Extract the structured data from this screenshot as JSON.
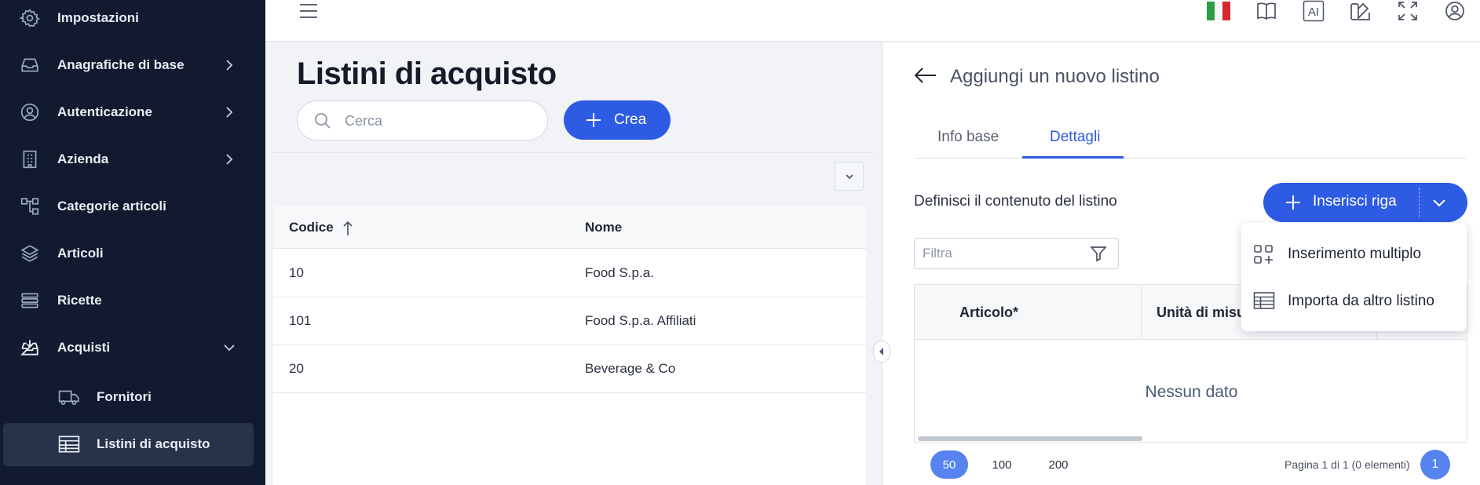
{
  "sidebar": {
    "items": [
      {
        "label": "Impostazioni",
        "icon": "gear-icon"
      },
      {
        "label": "Anagrafiche di base",
        "icon": "inbox-icon"
      },
      {
        "label": "Autenticazione",
        "icon": "user-circle-icon"
      },
      {
        "label": "Azienda",
        "icon": "building-icon"
      },
      {
        "label": "Categorie articoli",
        "icon": "hierarchy-icon"
      },
      {
        "label": "Articoli",
        "icon": "layers-icon"
      },
      {
        "label": "Ricette",
        "icon": "list-icon"
      },
      {
        "label": "Acquisti",
        "icon": "inbox-download-icon"
      }
    ],
    "sub_items": [
      {
        "label": "Fornitori",
        "icon": "truck-icon"
      },
      {
        "label": "Listini di acquisto",
        "icon": "table-icon"
      }
    ]
  },
  "topbar": {
    "icons": [
      "menu-icon",
      "italy-flag-icon",
      "book-icon",
      "ai-icon",
      "palette-icon",
      "fullscreen-icon",
      "user-account-icon"
    ],
    "ai_label": "AI"
  },
  "left": {
    "title": "Listini di acquisto",
    "search_placeholder": "Cerca",
    "create_label": "Crea",
    "columns": [
      "Codice",
      "Nome"
    ],
    "rows": [
      {
        "code": "10",
        "name": "Food S.p.a."
      },
      {
        "code": "101",
        "name": "Food S.p.a. Affiliati"
      },
      {
        "code": "20",
        "name": "Beverage & Co"
      }
    ]
  },
  "right": {
    "title": "Aggiungi un nuovo listino",
    "tabs": [
      "Info base",
      "Dettagli"
    ],
    "active_tab": "Dettagli",
    "section_label": "Definisci il contenuto del listino",
    "insert_label": "Inserisci riga",
    "filter_placeholder": "Filtra",
    "columns": [
      "Articolo*",
      "Unità di misura"
    ],
    "empty_text": "Nessun dato",
    "page_sizes": [
      "50",
      "100",
      "200"
    ],
    "active_page_size": "50",
    "page_info": "Pagina 1 di 1 (0 elementi)",
    "current_page": "1"
  },
  "menu": {
    "items": [
      {
        "label": "Inserimento multiplo",
        "icon": "grid-plus-icon"
      },
      {
        "label": "Importa da altro listino",
        "icon": "table-icon"
      }
    ]
  },
  "colors": {
    "sidebar_bg": "#111a2e",
    "accent": "#2d5be3",
    "pager_accent": "#5683ef"
  }
}
